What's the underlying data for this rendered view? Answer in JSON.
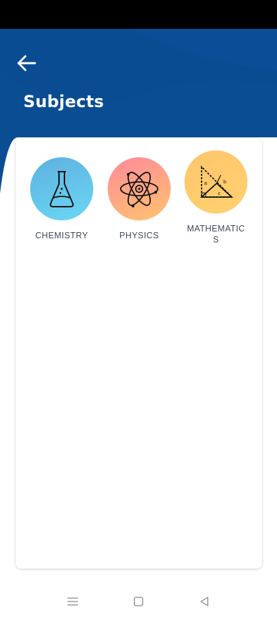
{
  "header": {
    "title": "Subjects",
    "back_icon": "arrow-left-icon",
    "colors": {
      "primary": "#0a4d93",
      "secondary": "#0b3f80"
    }
  },
  "subjects": [
    {
      "label": "CHEMISTRY",
      "icon": "flask-icon",
      "color_from": "#5fb0e0",
      "color_to": "#6ad8f4"
    },
    {
      "label": "PHYSICS",
      "icon": "atom-icon",
      "color_from": "#ff8a9a",
      "color_to": "#ffc36e"
    },
    {
      "label": "MATHEMATIC\nS",
      "icon": "triangle-ruler-icon",
      "color_from": "#ffc66b",
      "color_to": "#ffd070"
    }
  ],
  "navbar": {
    "items": [
      "menu-icon",
      "home-square-icon",
      "back-triangle-icon"
    ]
  }
}
